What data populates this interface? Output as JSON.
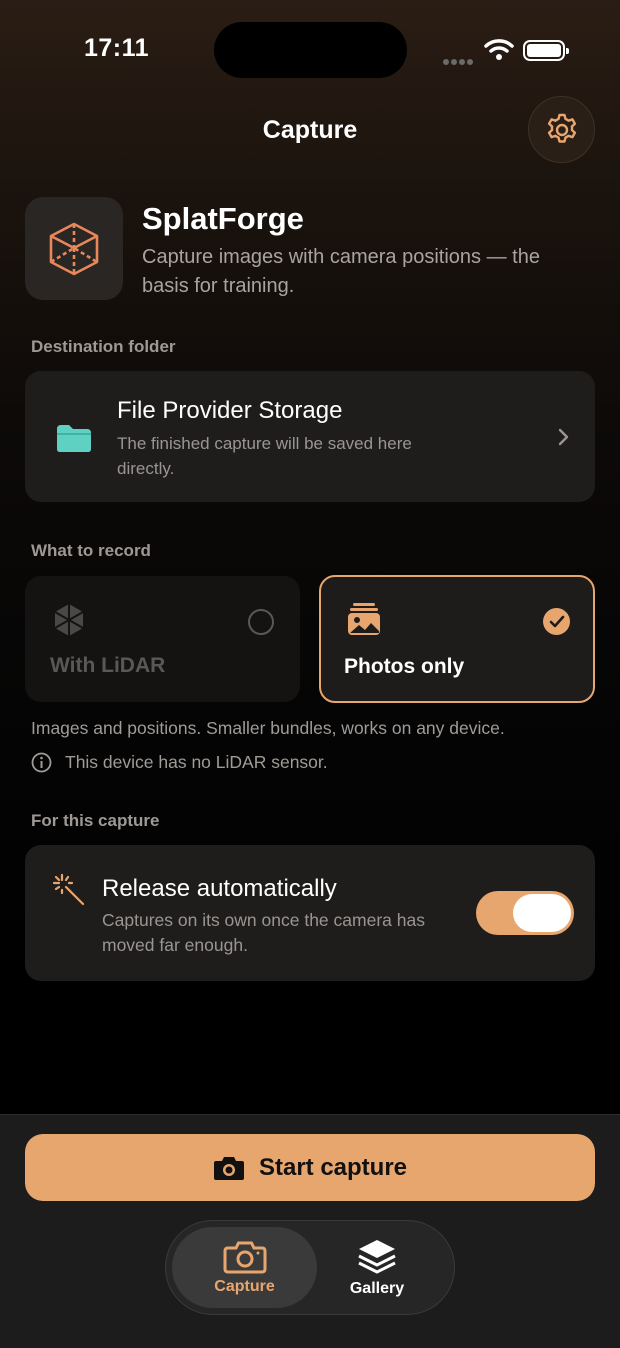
{
  "status_bar": {
    "time": "17:11"
  },
  "nav": {
    "title": "Capture",
    "settings_icon": "gear-icon"
  },
  "app": {
    "name": "SplatForge",
    "description": "Capture images with camera positions — the basis for training."
  },
  "destination": {
    "section_label": "Destination folder",
    "title": "File Provider Storage",
    "subtitle": "The finished capture will be saved here directly."
  },
  "record": {
    "section_label": "What to record",
    "options": [
      {
        "label": "With LiDAR",
        "selected": false,
        "enabled": false,
        "icon": "lidar-icon"
      },
      {
        "label": "Photos only",
        "selected": true,
        "enabled": true,
        "icon": "photos-icon"
      }
    ],
    "hint": "Images and positions. Smaller bundles, works on any device.",
    "note": "This device has no LiDAR sensor."
  },
  "capture_options": {
    "section_label": "For this capture",
    "release_title": "Release automatically",
    "release_subtitle": "Captures on its own once the camera has moved far enough.",
    "release_enabled": true
  },
  "actions": {
    "start_label": "Start capture"
  },
  "tabs": [
    {
      "label": "Capture",
      "active": true,
      "icon": "camera-icon"
    },
    {
      "label": "Gallery",
      "active": false,
      "icon": "stack-icon"
    }
  ],
  "colors": {
    "accent": "#e8a66f",
    "folder": "#5fd1c2",
    "card": "#1f1d1c"
  }
}
